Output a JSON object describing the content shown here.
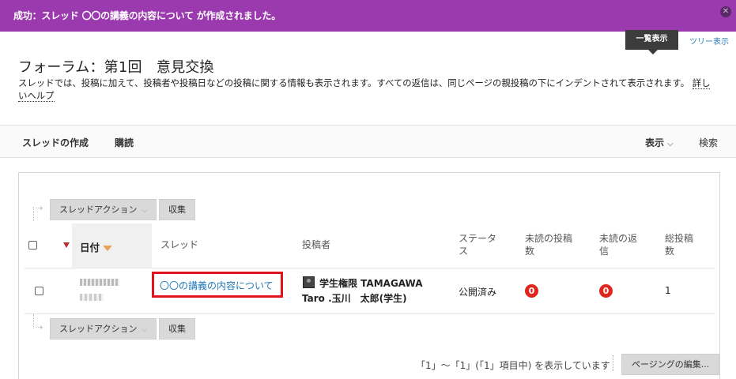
{
  "banner": {
    "message": "成功：スレッド 〇〇の講義の内容について が作成されました。",
    "close_icon": "close-icon"
  },
  "view_toggle": {
    "list": "一覧表示",
    "tree": "ツリー表示"
  },
  "page": {
    "title": "フォーラム：第1回　意見交換",
    "description": "スレッドでは、投稿に加えて、投稿者や投稿日などの投稿に関する情報も表示されます。すべての返信は、同じページの親投稿の下にインデントされて表示されます。",
    "help_link": "詳しいヘルプ"
  },
  "actions": {
    "create_thread": "スレッドの作成",
    "subscribe": "購読",
    "display": "表示",
    "search": "検索"
  },
  "toolbar": {
    "thread_action": "スレッドアクション",
    "collect": "収集"
  },
  "table": {
    "headers": {
      "date": "日付",
      "thread": "スレッド",
      "author": "投稿者",
      "status": "ステータス",
      "unread_posts": "未読の投稿数",
      "unread_replies": "未読の返信",
      "total_posts": "総投稿数"
    },
    "rows": [
      {
        "thread": "〇〇の講義の内容について",
        "author": "学生権限 TAMAGAWA Taro .玉川　太郎(学生)",
        "status": "公開済み",
        "unread_posts": "0",
        "unread_replies": "0",
        "total_posts": "1"
      }
    ]
  },
  "paging": {
    "info": "「1」～「1」(「1」項目中) を表示しています",
    "edit_button": "ページングの編集..."
  },
  "colors": {
    "banner": "#9b3aaf",
    "link": "#1f77b4",
    "highlight_box": "#e2141b",
    "badge": "#e0261c"
  }
}
